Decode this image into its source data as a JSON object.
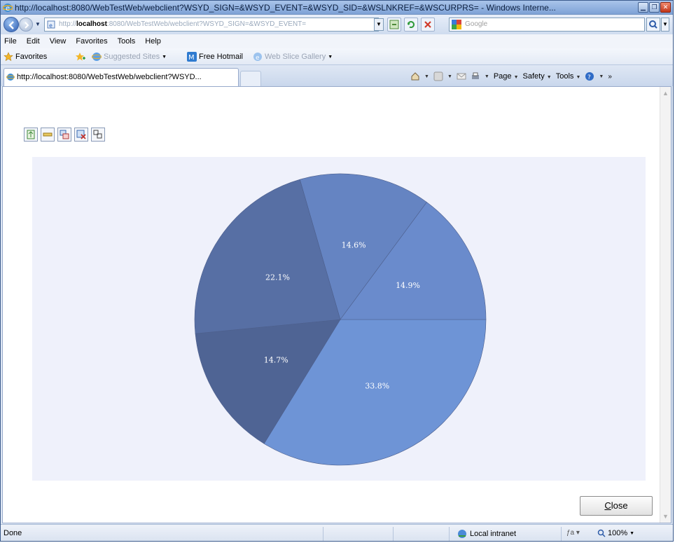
{
  "window": {
    "title": "http://localhost:8080/WebTestWeb/webclient?WSYD_SIGN=&WSYD_EVENT=&WSYD_SID=&WSLNKREF=&WSCURPRS= - Windows Interne...",
    "buttons": [
      "minimize",
      "restore",
      "close"
    ]
  },
  "address": {
    "url_prefix": "http://",
    "url_host": "localhost",
    "url_rest": ":8080/WebTestWeb/webclient?WSYD_SIGN=&WSYD_EVENT=",
    "search_placeholder": "Google"
  },
  "menu": [
    {
      "label": "File",
      "key": "F"
    },
    {
      "label": "Edit",
      "key": "E"
    },
    {
      "label": "View",
      "key": "V"
    },
    {
      "label": "Favorites",
      "key": "a"
    },
    {
      "label": "Tools",
      "key": "T"
    },
    {
      "label": "Help",
      "key": "H"
    }
  ],
  "favorites_bar": {
    "favorites_label": "Favorites",
    "suggested_sites": "Suggested Sites",
    "free_hotmail": "Free Hotmail",
    "web_slice_gallery": "Web Slice Gallery"
  },
  "tab": {
    "label": "http://localhost:8080/WebTestWeb/webclient?WSYD..."
  },
  "command_bar": {
    "page": "Page",
    "safety": "Safety",
    "tools": "Tools"
  },
  "content": {
    "close_button": "Close"
  },
  "chart_data": {
    "type": "pie",
    "slices": [
      {
        "label": "33.8%",
        "value": 33.8,
        "color": "#6e94d6"
      },
      {
        "label": "14.7%",
        "value": 14.7,
        "color": "#4f6494"
      },
      {
        "label": "22.1%",
        "value": 22.1,
        "color": "#576fa4"
      },
      {
        "label": "14.6%",
        "value": 14.6,
        "color": "#6584c2"
      },
      {
        "label": "14.9%",
        "value": 14.9,
        "color": "#6a8bcc"
      }
    ],
    "start_angle_deg": 0,
    "direction": "clockwise",
    "background": "#eff1fb"
  },
  "status": {
    "text": "Done",
    "zone": "Local intranet",
    "zoom": "100%"
  }
}
